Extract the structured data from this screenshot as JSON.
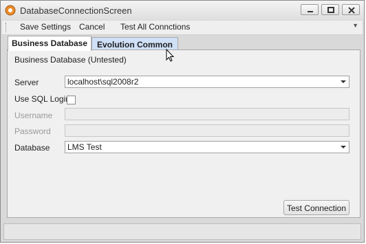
{
  "window": {
    "title": "DatabaseConnectionScreen",
    "icons": {
      "app": "gear-app-icon",
      "minimize": "minimize-icon",
      "maximize": "maximize-icon",
      "close": "close-icon"
    }
  },
  "menu": {
    "items": [
      "Save Settings",
      "Cancel",
      "Test All Connctions"
    ],
    "overflow_icon": "chevron-down-icon"
  },
  "tabs": [
    {
      "label": "Business Database",
      "active": true
    },
    {
      "label": "Evolution Common",
      "active": false
    }
  ],
  "form": {
    "section_title": "Business Database (Untested)",
    "server_label": "Server",
    "server_value": "localhost\\sql2008r2",
    "use_sql_login_label": "Use SQL Login",
    "use_sql_login_checked": false,
    "username_label": "Username",
    "username_value": "",
    "password_label": "Password",
    "password_value": "",
    "database_label": "Database",
    "database_value": "LMS Test",
    "test_button": "Test Connection"
  },
  "colors": {
    "tab_inactive_bg": "#cfe0f7",
    "window_bg": "#d9d9d9",
    "panel_bg": "#f0f0f0"
  }
}
